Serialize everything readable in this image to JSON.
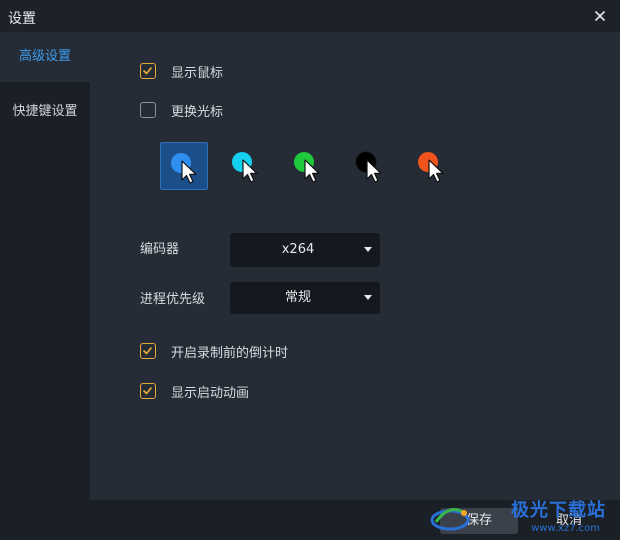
{
  "window": {
    "title": "设置"
  },
  "sidebar": {
    "items": [
      {
        "label": "高级设置",
        "active": true
      },
      {
        "label": "快捷键设置",
        "active": false
      }
    ]
  },
  "settings": {
    "show_mouse": {
      "label": "显示鼠标",
      "checked": true
    },
    "change_cursor": {
      "label": "更换光标",
      "checked": false
    },
    "cursor_colors": [
      "#2f8ff0",
      "#14d2ef",
      "#1fc93c",
      "#000000",
      "#f0531c"
    ],
    "cursor_selected_index": 0,
    "encoder": {
      "label": "编码器",
      "value": "x264"
    },
    "priority": {
      "label": "进程优先级",
      "value": "常规"
    },
    "countdown": {
      "label": "开启录制前的倒计时",
      "checked": true
    },
    "startup_animation": {
      "label": "显示启动动画",
      "checked": true
    }
  },
  "footer": {
    "save_label": "保存",
    "cancel_label": "取消"
  },
  "watermark": {
    "text": "极光下载站",
    "url": "www.xz7.com"
  },
  "colors": {
    "accent": "#3d9cf0",
    "checkbox": "#e8a83a"
  }
}
